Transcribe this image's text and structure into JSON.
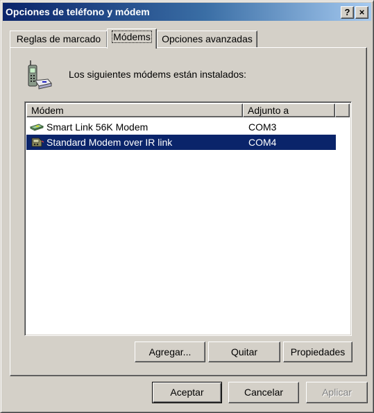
{
  "window": {
    "title": "Opciones de teléfono y módem",
    "help_button": "?",
    "close_button": "×"
  },
  "tabs": [
    {
      "label": "Reglas de marcado",
      "active": false
    },
    {
      "label": "Módems",
      "active": true
    },
    {
      "label": "Opciones avanzadas",
      "active": false
    }
  ],
  "modems_tab": {
    "intro_text": "Los siguientes módems están instalados:",
    "icon": "phone-modem-icon",
    "columns": [
      "Módem",
      "Adjunto a"
    ],
    "rows": [
      {
        "name": "Smart Link 56K Modem",
        "port": "COM3",
        "icon": "modem-icon",
        "selected": false
      },
      {
        "name": "Standard Modem over IR link",
        "port": "COM4",
        "icon": "ir-modem-icon",
        "selected": true
      }
    ],
    "buttons": {
      "add": "Agregar...",
      "remove": "Quitar",
      "properties": "Propiedades"
    }
  },
  "dialog_buttons": {
    "ok": "Aceptar",
    "cancel": "Cancelar",
    "apply": "Aplicar",
    "apply_enabled": false
  },
  "colors": {
    "title_start": "#0a246a",
    "title_end": "#a6caf0",
    "selection": "#0a246a",
    "face": "#d4d0c8"
  }
}
